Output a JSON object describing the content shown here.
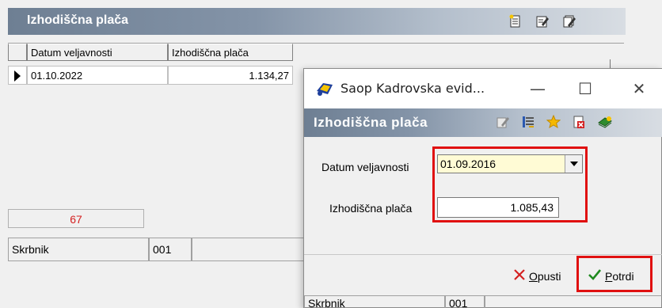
{
  "back_window": {
    "title": "Izhodiščna plača",
    "toolbar_icons": [
      "new-document-icon",
      "edit-icon",
      "edit-multiple-icon"
    ],
    "table": {
      "columns": [
        "Datum veljavnosti",
        "Izhodiščna plača"
      ],
      "rows": [
        {
          "date": "01.10.2022",
          "amount": "1.134,27"
        }
      ]
    },
    "counter": "67",
    "status": {
      "label": "Skrbnik",
      "code": "001"
    }
  },
  "dialog": {
    "window_title": "Saop Kadrovska evid...",
    "window_controls": {
      "minimize": "—",
      "maximize": "☐",
      "close": "✕"
    },
    "header_title": "Izhodiščna plača",
    "header_icons": [
      "edit-icon",
      "list-icon",
      "star-icon",
      "delete-icon",
      "help-book-icon"
    ],
    "fields": {
      "date_label": "Datum veljavnosti",
      "date_value": "01.09.2016",
      "amount_label": "Izhodiščna plača",
      "amount_value": "1.085,43"
    },
    "buttons": {
      "cancel": "Opusti",
      "confirm": "Potrdi"
    },
    "status": {
      "label": "Skrbnik",
      "code": "001"
    },
    "colors": {
      "highlight": "#e01010",
      "combo_bg": "#fffbd5"
    }
  }
}
